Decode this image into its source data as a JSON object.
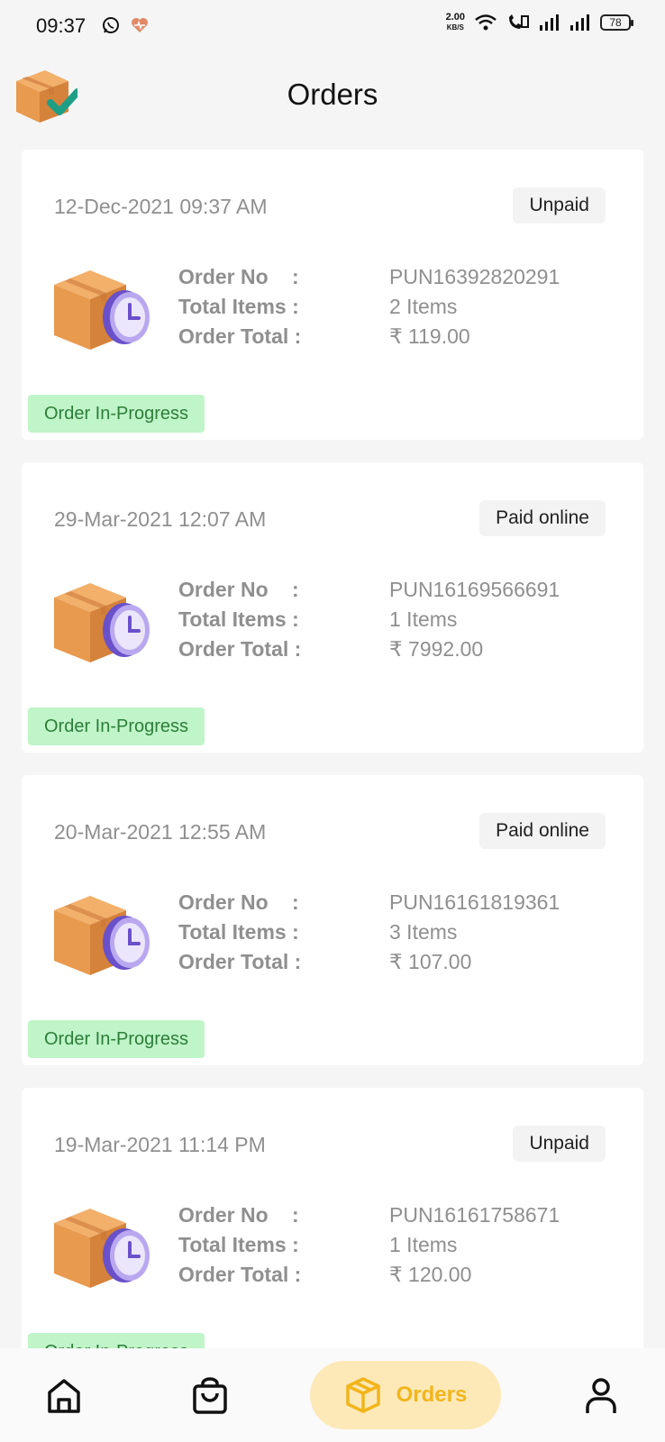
{
  "status_bar": {
    "time": "09:37",
    "speed_value": "2.00",
    "speed_unit": "KB/S",
    "battery": "78"
  },
  "header": {
    "title": "Orders"
  },
  "orders": [
    {
      "date": "12-Dec-2021 09:37 AM",
      "payment_status": "Unpaid",
      "order_no_label": "Order No",
      "order_no": "PUN16392820291",
      "total_items_label": "Total Items :",
      "total_items": "2 Items",
      "order_total_label": "Order Total :",
      "order_total": "₹ 119.00",
      "status": "Order In-Progress"
    },
    {
      "date": "29-Mar-2021 12:07 AM",
      "payment_status": "Paid online",
      "order_no_label": "Order No",
      "order_no": "PUN16169566691",
      "total_items_label": "Total Items :",
      "total_items": "1 Items",
      "order_total_label": "Order Total :",
      "order_total": "₹ 7992.00",
      "status": "Order In-Progress"
    },
    {
      "date": "20-Mar-2021 12:55 AM",
      "payment_status": "Paid online",
      "order_no_label": "Order No",
      "order_no": "PUN16161819361",
      "total_items_label": "Total Items :",
      "total_items": "3 Items",
      "order_total_label": "Order Total :",
      "order_total": "₹ 107.00",
      "status": "Order In-Progress"
    },
    {
      "date": "19-Mar-2021 11:14 PM",
      "payment_status": "Unpaid",
      "order_no_label": "Order No",
      "order_no": "PUN16161758671",
      "total_items_label": "Total Items :",
      "total_items": "1 Items",
      "order_total_label": "Order Total :",
      "order_total": "₹ 120.00",
      "status": "Order In-Progress"
    }
  ],
  "bottom_nav": {
    "home_icon": "home-icon",
    "cart_icon": "shopping-bag-icon",
    "orders_label": "Orders",
    "profile_icon": "user-icon",
    "active_color": "#f2b51b",
    "active_bg": "#fde9b8"
  },
  "colors": {
    "status_chip_bg": "#bff5c8",
    "status_chip_text": "#2e7d3a",
    "muted_text": "#8f8f8f"
  }
}
